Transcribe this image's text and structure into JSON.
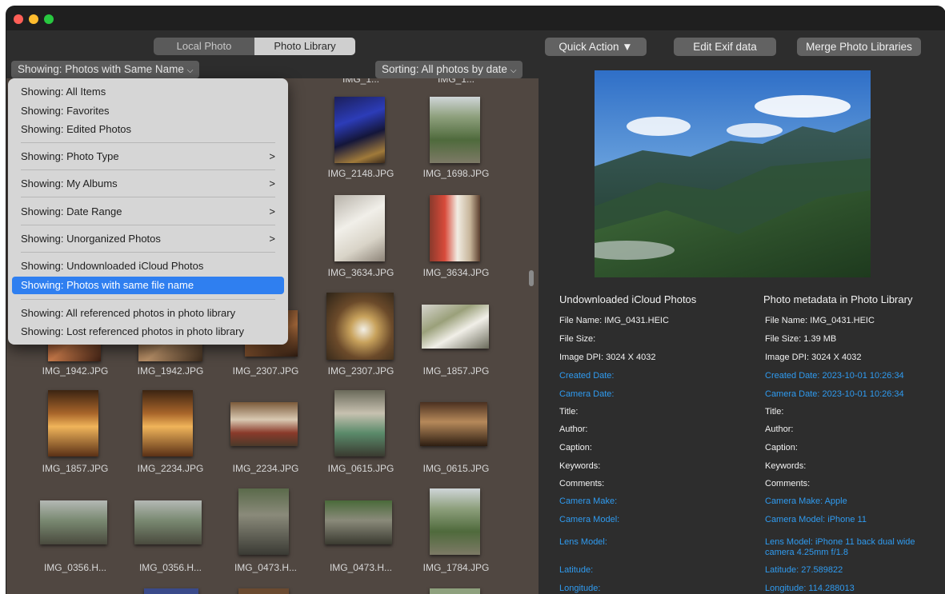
{
  "toolbar": {
    "tabs": [
      {
        "label": "Local Photo",
        "active": false
      },
      {
        "label": "Photo Library",
        "active": true
      }
    ],
    "quick_action": "Quick Action ▼",
    "edit_exif": "Edit Exif data",
    "merge": "Merge Photo Libraries"
  },
  "filters": {
    "showing": "Showing: Photos with Same Name",
    "sorting": "Sorting: All photos by date"
  },
  "menu": {
    "items": [
      {
        "label": "Showing: All Items"
      },
      {
        "label": "Showing: Favorites"
      },
      {
        "label": "Showing: Edited Photos"
      },
      {
        "label": "Showing: Photo Type",
        "submenu": true
      },
      {
        "label": "Showing: My Albums",
        "submenu": true
      },
      {
        "label": "Showing: Date Range",
        "submenu": true
      },
      {
        "label": "Showing: Unorganized Photos",
        "submenu": true
      },
      {
        "label": "Showing: Undownloaded iCloud Photos"
      },
      {
        "label": "Showing: Photos with same file name",
        "selected": true
      },
      {
        "label": "Showing: All referenced photos in photo library"
      },
      {
        "label": "Showing: Lost referenced photos in photo library"
      }
    ],
    "submenu_arrow": ">"
  },
  "grid": {
    "partial_top": [
      "IMG_1...",
      "IMG_1..."
    ],
    "rows": [
      [
        "",
        "",
        "PG",
        "IMG_2148.JPG",
        "IMG_1698.JPG"
      ],
      [
        "",
        "",
        "PG",
        "IMG_3634.JPG",
        "IMG_3634.JPG"
      ],
      [
        "IMG_1942.JPG",
        "IMG_1942.JPG",
        "IMG_2307.JPG",
        "IMG_2307.JPG",
        "IMG_1857.JPG"
      ],
      [
        "IMG_1857.JPG",
        "IMG_2234.JPG",
        "IMG_2234.JPG",
        "IMG_0615.JPG",
        "IMG_0615.JPG"
      ],
      [
        "IMG_0356.H...",
        "IMG_0356.H...",
        "IMG_0473.H...",
        "IMG_0473.H...",
        "IMG_1784.JPG"
      ]
    ]
  },
  "details": {
    "left_title": "Undownloaded iCloud Photos",
    "right_title": "Photo metadata in Photo Library",
    "left": [
      {
        "text": "File Name: IMG_0431.HEIC",
        "blue": false
      },
      {
        "text": "File Size:",
        "blue": false
      },
      {
        "text": "Image DPI: 3024 X 4032",
        "blue": false
      },
      {
        "text": "Created Date:",
        "blue": true
      },
      {
        "text": "Camera Date:",
        "blue": true
      },
      {
        "text": "Title:",
        "blue": false
      },
      {
        "text": "Author:",
        "blue": false
      },
      {
        "text": "Caption:",
        "blue": false
      },
      {
        "text": "Keywords:",
        "blue": false
      },
      {
        "text": "Comments:",
        "blue": false
      },
      {
        "text": "Camera Make:",
        "blue": true
      },
      {
        "text": "Camera Model:",
        "blue": true
      },
      {
        "text": "Lens Model:",
        "blue": true
      },
      {
        "text": "Latitude:",
        "blue": true
      },
      {
        "text": "Longitude:",
        "blue": true
      }
    ],
    "right": [
      {
        "text": "File Name: IMG_0431.HEIC",
        "blue": false
      },
      {
        "text": "File Size: 1.39 MB",
        "blue": false
      },
      {
        "text": "Image DPI: 3024 X 4032",
        "blue": false
      },
      {
        "text": "Created Date: 2023-10-01 10:26:34",
        "blue": true
      },
      {
        "text": "Camera Date: 2023-10-01 10:26:34",
        "blue": true
      },
      {
        "text": "Title:",
        "blue": false
      },
      {
        "text": "Author:",
        "blue": false
      },
      {
        "text": "Caption:",
        "blue": false
      },
      {
        "text": "Keywords:",
        "blue": false
      },
      {
        "text": "Comments:",
        "blue": false
      },
      {
        "text": "Camera Make: Apple",
        "blue": true
      },
      {
        "text": "Camera Model: iPhone 11",
        "blue": true
      },
      {
        "text": "Lens Model: iPhone 11 back dual wide",
        "blue": true
      },
      {
        "text": "camera 4.25mm f/1.8",
        "blue": true
      },
      {
        "text": "Latitude: 27.589822",
        "blue": true
      },
      {
        "text": "Longitude: 114.288013",
        "blue": true
      }
    ]
  },
  "colors": {
    "accent": "#2f7ff0",
    "metadata_blue": "#2f9bf0"
  }
}
